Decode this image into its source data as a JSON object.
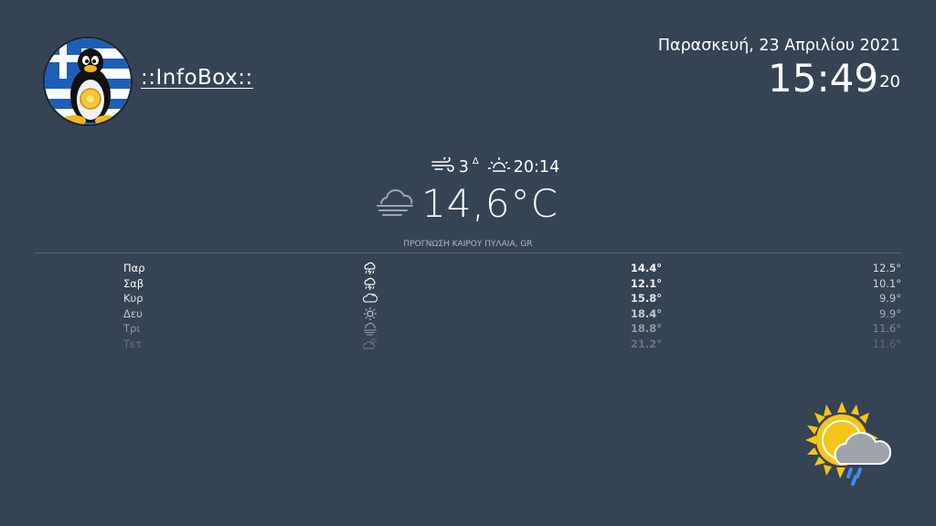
{
  "brand": {
    "name": "::InfoBox::"
  },
  "datetime": {
    "date": "Παρασκευή, 23 Απριλίου 2021",
    "time": "15:49",
    "seconds": "20"
  },
  "current": {
    "wind_speed": "3",
    "wind_sup": "Δ",
    "sunset": "20:14",
    "temperature": "14,6°C",
    "icon": "fog-cloud-icon"
  },
  "forecast": {
    "header": "ΠΡΟΓΝΩΣΗ ΚΑΙΡΟΥ ΠΥΛΑΙΑ, GR",
    "rows": [
      {
        "day": "Παρ",
        "icon": "thunderstorm-icon",
        "max": "14.4°",
        "min": "12.5°"
      },
      {
        "day": "Σαβ",
        "icon": "thunderstorm-icon",
        "max": "12.1°",
        "min": "10.1°"
      },
      {
        "day": "Κυρ",
        "icon": "cloudy-icon",
        "max": "15.8°",
        "min": "9.9°"
      },
      {
        "day": "Δευ",
        "icon": "sun-icon",
        "max": "18.4°",
        "min": "9.9°"
      },
      {
        "day": "Τρι",
        "icon": "fog-cloud-icon",
        "max": "18.8°",
        "min": "11.6°"
      },
      {
        "day": "Τετ",
        "icon": "partly-cloudy-icon",
        "max": "21.2°",
        "min": "11.6°"
      }
    ]
  },
  "colors": {
    "background": "#364354",
    "sun": "#f5c518",
    "rain": "#3f8ee6",
    "cloud": "#9ea4aa"
  },
  "big_icon": "sun-cloud-rain-icon"
}
